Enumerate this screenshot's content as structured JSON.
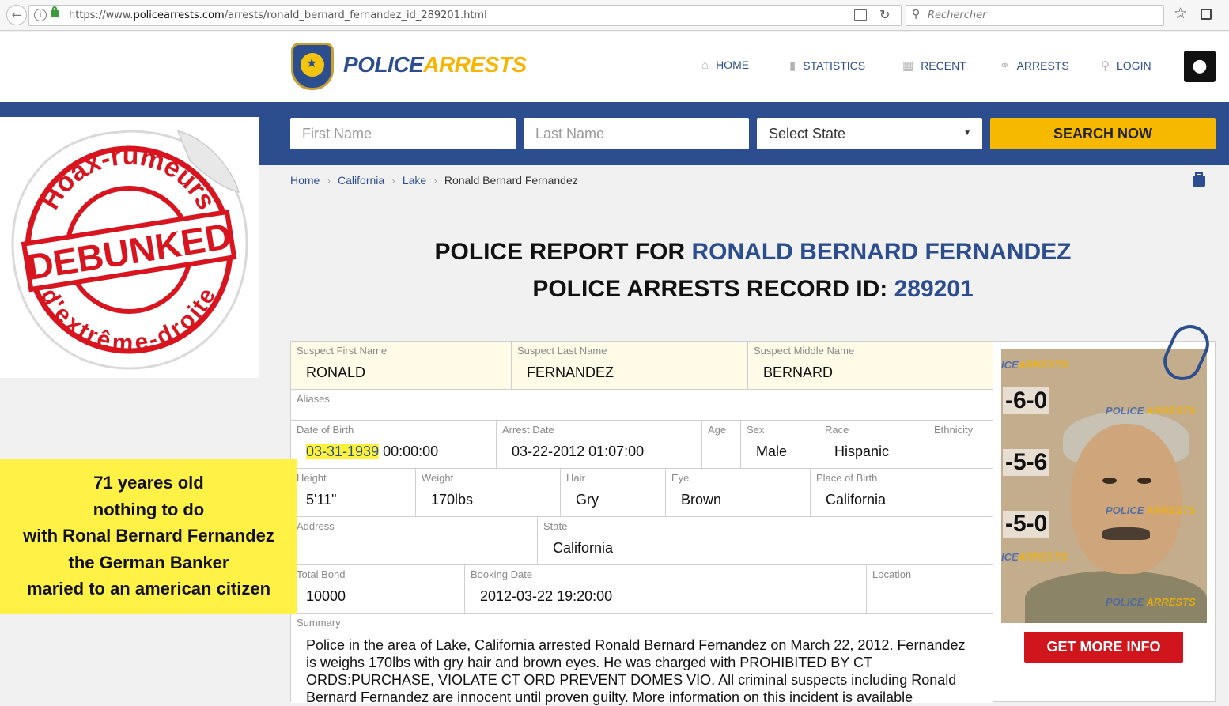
{
  "browser": {
    "url_prefix": "https://www.",
    "url_domain": "policearrests.com",
    "url_path": "/arrests/ronald_bernard_fernandez_id_289201.html",
    "search_placeholder": "Rechercher",
    "icons": [
      "back-arrow-icon",
      "info-icon",
      "lock-icon",
      "reader-view-icon",
      "reload-icon",
      "search-icon",
      "bookmark-star-icon",
      "library-icon"
    ]
  },
  "site": {
    "logo_police": "POLICE",
    "logo_arrests": "ARRESTS",
    "badge_text_top": "POLICE",
    "badge_text_bottom": "ARRESTS",
    "nav": [
      {
        "label": "HOME",
        "icon": "home-icon"
      },
      {
        "label": "STATISTICS",
        "icon": "bar-chart-icon"
      },
      {
        "label": "RECENT",
        "icon": "calendar-icon"
      },
      {
        "label": "ARRESTS",
        "icon": "handcuffs-icon"
      },
      {
        "label": "LOGIN",
        "icon": "key-icon"
      }
    ],
    "apple_icon": "apple-icon"
  },
  "search": {
    "first_name_placeholder": "First Name",
    "last_name_placeholder": "Last Name",
    "state_selected": "Select State",
    "search_label": "SEARCH NOW"
  },
  "sticker": {
    "arc_top": "Hoax-rumeurs",
    "center": "DEBUNKED",
    "arc_bottom": "d'extrême-droite"
  },
  "breadcrumb": {
    "home": "Home",
    "state": "California",
    "county": "Lake",
    "current": "Ronald Bernard Fernandez"
  },
  "title": {
    "line1_prefix": "POLICE REPORT FOR ",
    "line1_name": "RONALD BERNARD FERNANDEZ",
    "line2_prefix": "POLICE ARRESTS RECORD ID: ",
    "line2_id": "289201"
  },
  "record": {
    "first_name": {
      "label": "Suspect First Name",
      "value": "RONALD"
    },
    "last_name": {
      "label": "Suspect Last Name",
      "value": "FERNANDEZ"
    },
    "middle_name": {
      "label": "Suspect Middle Name",
      "value": "BERNARD"
    },
    "aliases": {
      "label": "Aliases",
      "value": ""
    },
    "dob": {
      "label": "Date of Birth",
      "value_date": "03-31-1939",
      "value_time": " 00:00:00"
    },
    "arrest_date": {
      "label": "Arrest Date",
      "value": "03-22-2012 01:07:00"
    },
    "age": {
      "label": "Age",
      "value": ""
    },
    "sex": {
      "label": "Sex",
      "value": "Male"
    },
    "race": {
      "label": "Race",
      "value": "Hispanic"
    },
    "ethnicity": {
      "label": "Ethnicity",
      "value": ""
    },
    "height": {
      "label": "Height",
      "value": "5'11\""
    },
    "weight": {
      "label": "Weight",
      "value": "170lbs"
    },
    "hair": {
      "label": "Hair",
      "value": "Gry"
    },
    "eye": {
      "label": "Eye",
      "value": "Brown"
    },
    "place_of_birth": {
      "label": "Place of Birth",
      "value": "California"
    },
    "address": {
      "label": "Address",
      "value": ""
    },
    "state": {
      "label": "State",
      "value": "California"
    },
    "total_bond": {
      "label": "Total Bond",
      "value": "10000"
    },
    "booking_date": {
      "label": "Booking Date",
      "value": "2012-03-22 19:20:00"
    },
    "location": {
      "label": "Location",
      "value": ""
    },
    "summary_label": "Summary",
    "summary_text": "Police in the area of Lake, California arrested Ronald Bernard Fernandez on March 22, 2012. Fernandez is weighs 170lbs with gry hair and brown eyes. He was charged with PROHIBITED BY CT ORDS:PURCHASE, VIOLATE CT ORD PREVENT DOMES VIO.  All criminal suspects including Ronald Bernard Fernandez are innocent until proven guilty. More information on this incident is available"
  },
  "mugshot": {
    "ruler_marks": [
      "-6-0",
      "-5-6",
      "-5-0"
    ],
    "watermark_a": "ICE",
    "watermark_b": "ARRESTS",
    "watermark_c": "POLICE"
  },
  "more_info_label": "GET MORE INFO",
  "annotation": {
    "lines": [
      "71 yeares old",
      "nothing to do",
      "with Ronal Bernard Fernandez",
      "the German Banker",
      "maried to an american citizen"
    ]
  },
  "colors": {
    "brand_blue": "#2d4e8e",
    "brand_yellow": "#f7b900",
    "cta_red": "#d0161c",
    "annotation_yellow": "#fff145",
    "stamp_red": "#d8151f"
  }
}
